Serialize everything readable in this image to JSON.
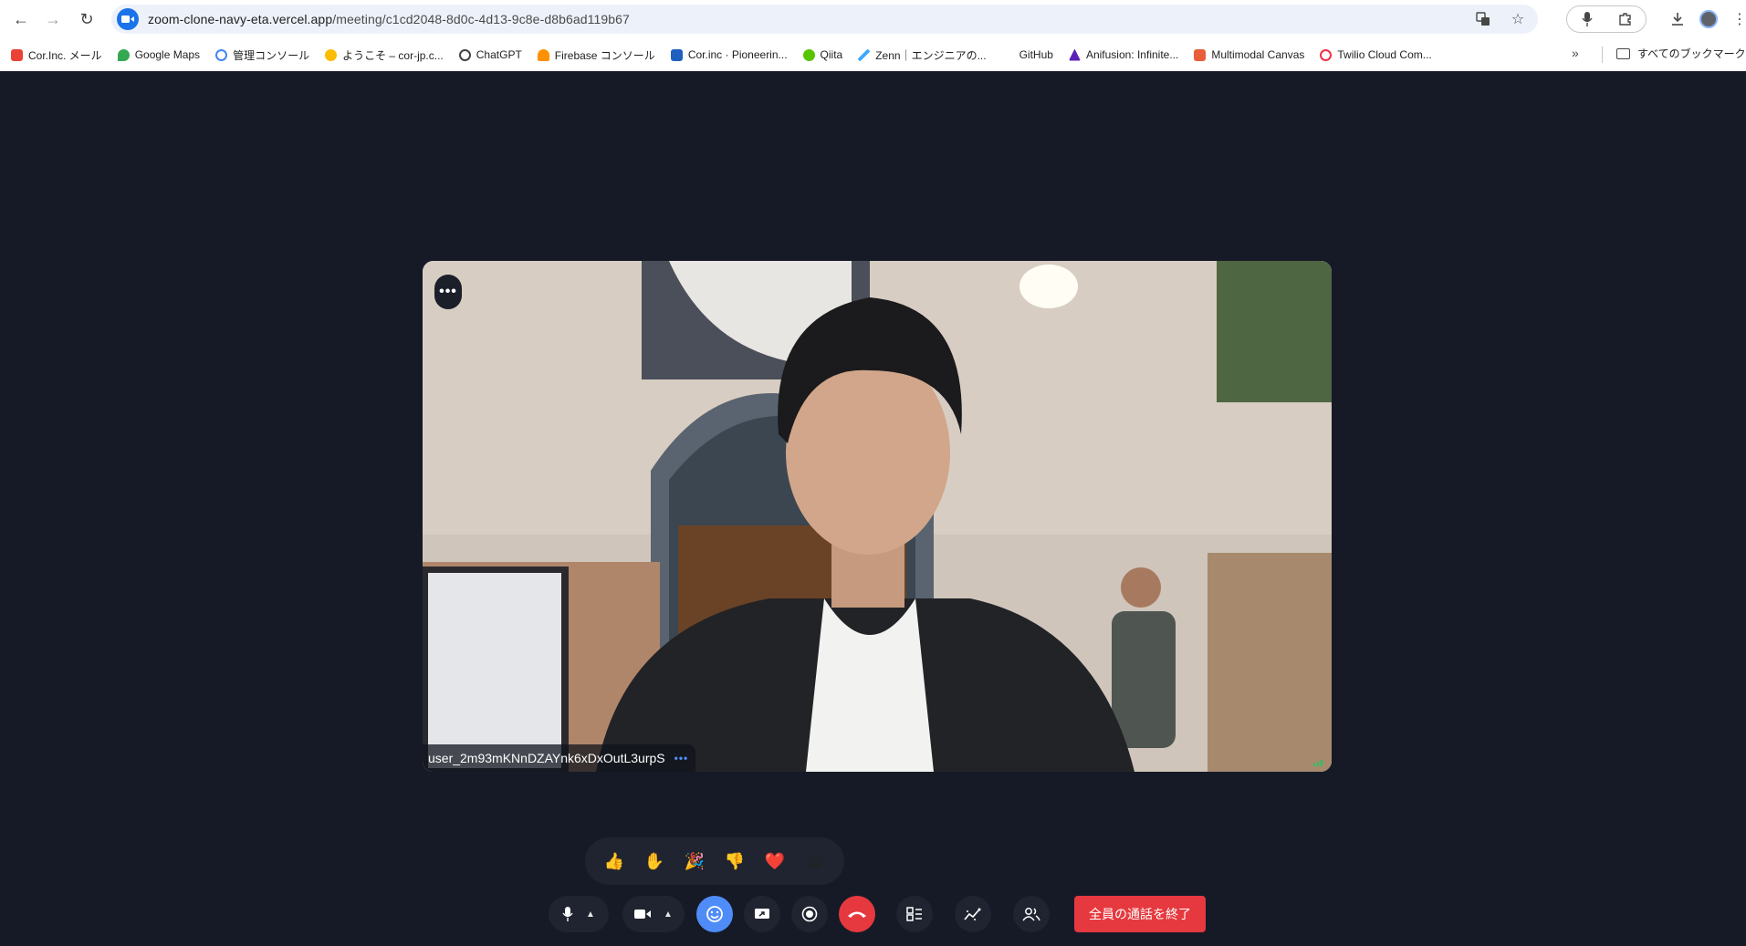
{
  "browser": {
    "url_host": "zoom-clone-navy-eta.vercel.app",
    "url_path": "/meeting/c1cd2048-8d0c-4d13-9c8e-d8b6ad119b67",
    "bookmarks": [
      {
        "label": "Cor.Inc. メール",
        "icon": "gmail-icon",
        "color": "#ea4335"
      },
      {
        "label": "Google Maps",
        "icon": "maps-pin-icon",
        "color": "#34a853"
      },
      {
        "label": "管理コンソール",
        "icon": "google-g-icon",
        "color": "#4285f4"
      },
      {
        "label": "ようこそ – cor-jp.c...",
        "icon": "cloud-icon",
        "color": "#fbbc04"
      },
      {
        "label": "ChatGPT",
        "icon": "openai-icon",
        "color": "#444444"
      },
      {
        "label": "Firebase コンソール",
        "icon": "firebase-icon",
        "color": "#ff9100"
      },
      {
        "label": "Cor.inc · Pioneerin...",
        "icon": "cor-icon",
        "color": "#1f5fbf"
      },
      {
        "label": "Qiita",
        "icon": "qiita-icon",
        "color": "#55c500"
      },
      {
        "label": "Zenn｜エンジニアの...",
        "icon": "zenn-icon",
        "color": "#3ea8ff"
      },
      {
        "label": "GitHub",
        "icon": "blank-icon",
        "color": "#ffffff"
      },
      {
        "label": "Anifusion: Infinite...",
        "icon": "anifusion-icon",
        "color": "#5b21b6"
      },
      {
        "label": "Multimodal Canvas",
        "icon": "canvas-icon",
        "color": "#e85d3a"
      },
      {
        "label": "Twilio Cloud Com...",
        "icon": "twilio-icon",
        "color": "#f22f46"
      }
    ],
    "all_bookmarks_label": "すべてのブックマーク"
  },
  "meeting": {
    "participant_name": "user_2m93mKNnDZAYnk6xDxOutL3urpS",
    "tile_options_label": "•••",
    "name_options_label": "•••",
    "reactions": [
      {
        "emoji": "👍",
        "name": "thumbs-up"
      },
      {
        "emoji": "✋",
        "name": "raised-hand"
      },
      {
        "emoji": "🎉",
        "name": "party-popper"
      },
      {
        "emoji": "👎",
        "name": "thumbs-down"
      },
      {
        "emoji": "❤️",
        "name": "heart"
      },
      {
        "emoji": "😀",
        "name": "grinning-face"
      }
    ],
    "end_call_label": "全員の通話を終了",
    "colors": {
      "background": "#161a27",
      "control_bg": "#1f2430",
      "accent_blue": "#4f8cf7",
      "leave_red": "#e5393f",
      "speaking_green": "#23c55e"
    }
  }
}
